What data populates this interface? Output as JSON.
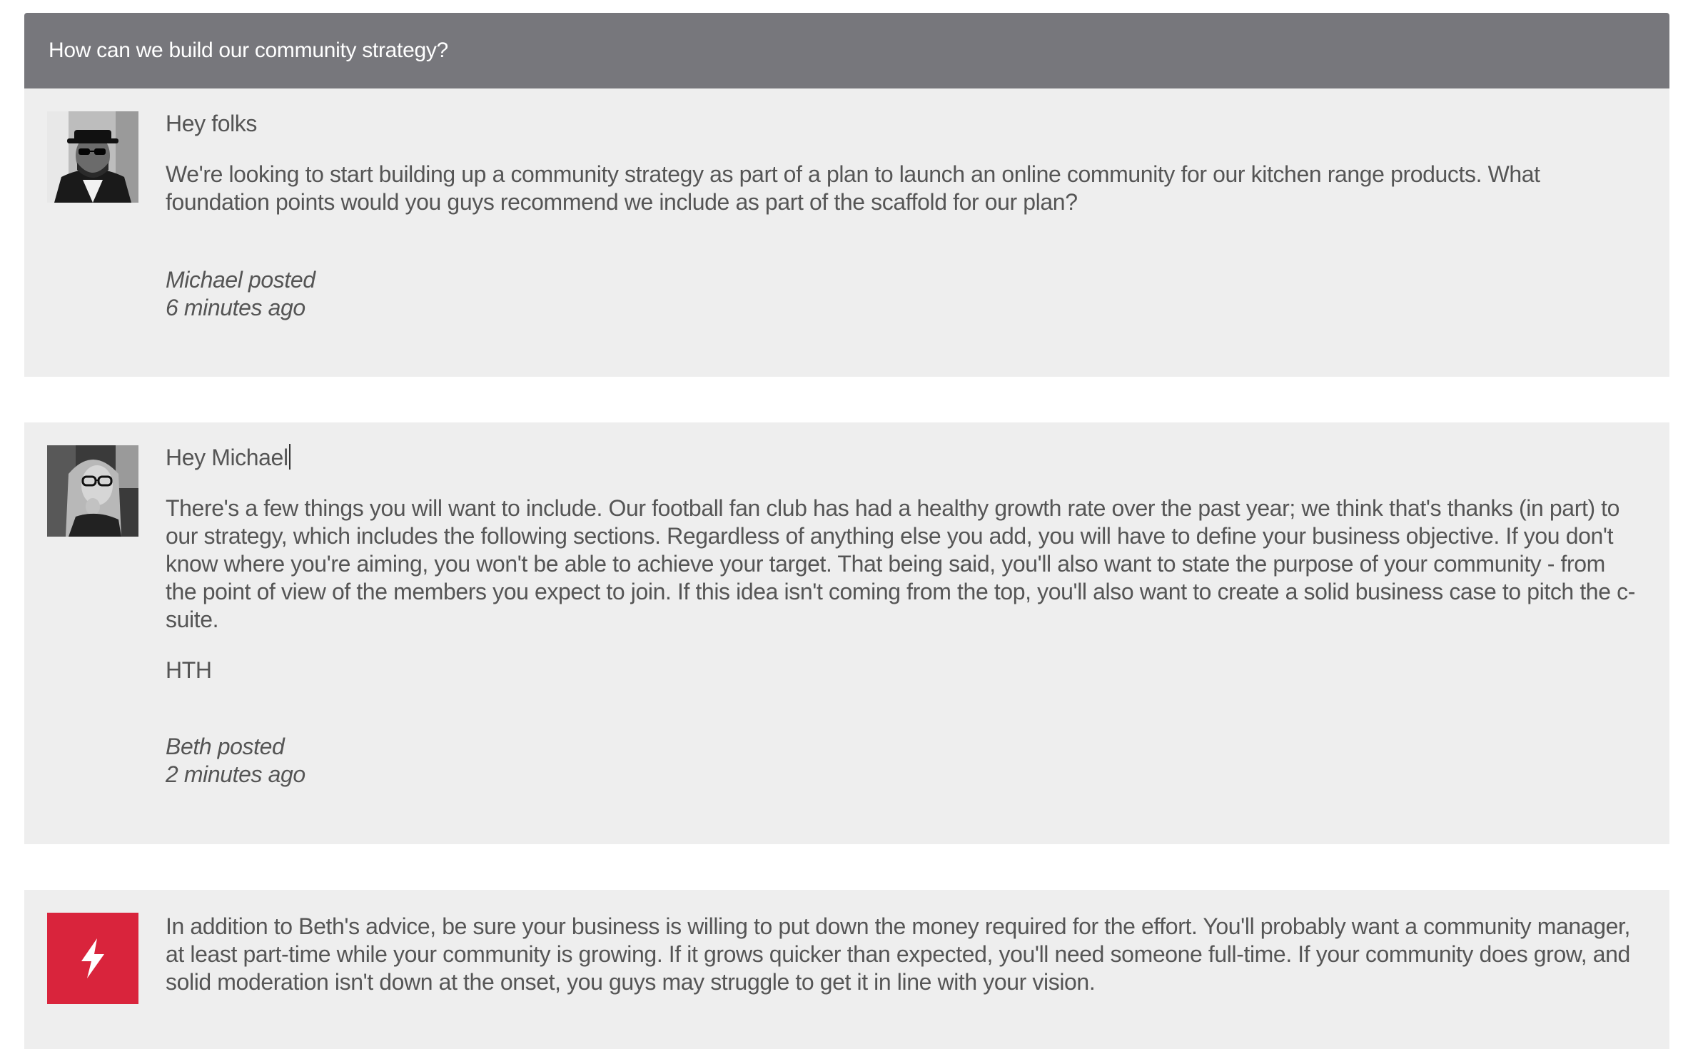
{
  "thread": {
    "title": "How can we build our community strategy?"
  },
  "posts": [
    {
      "greeting": "Hey folks",
      "paragraphs": [
        "We're looking to start building up a community strategy as part of a plan to launch an online community for our kitchen range products. What foundation points would you guys recommend we include as part of the scaffold for our plan?"
      ],
      "author_line": "Michael posted",
      "time": "6 minutes ago",
      "avatar_icon": "user-avatar-man-hat-sunglasses"
    },
    {
      "greeting": "Hey Michael",
      "paragraphs": [
        "There's a few things you will want to include. Our football fan club has had a healthy growth rate over the past year; we think that's thanks (in part) to our strategy, which includes the following sections. Regardless of anything else you add, you will have to define your business objective. If you don't know where you're aiming, you won't be able to achieve your target. That being said, you'll also want to state the purpose of your community - from the point of view of the members you expect to join. If this idea isn't coming from the top, you'll also want to create a solid business case to pitch the c-suite.",
        "HTH"
      ],
      "author_line": "Beth posted",
      "time": "2 minutes ago",
      "avatar_icon": "user-avatar-woman-glasses"
    },
    {
      "paragraphs": [
        "In addition to Beth's advice, be sure your business is willing to put down the money required for the effort. You'll probably want a community manager, at least part-time while your community is growing. If it grows quicker than expected, you'll need someone full-time. If your community does grow, and solid moderation isn't down at the onset, you guys may struggle to get it in line with your vision."
      ],
      "avatar_icon": "lightning-bolt-icon"
    }
  ],
  "colors": {
    "header_bg": "#77777c",
    "post_bg": "#eeeeee",
    "brand_red": "#d9243c",
    "text": "#555555"
  }
}
